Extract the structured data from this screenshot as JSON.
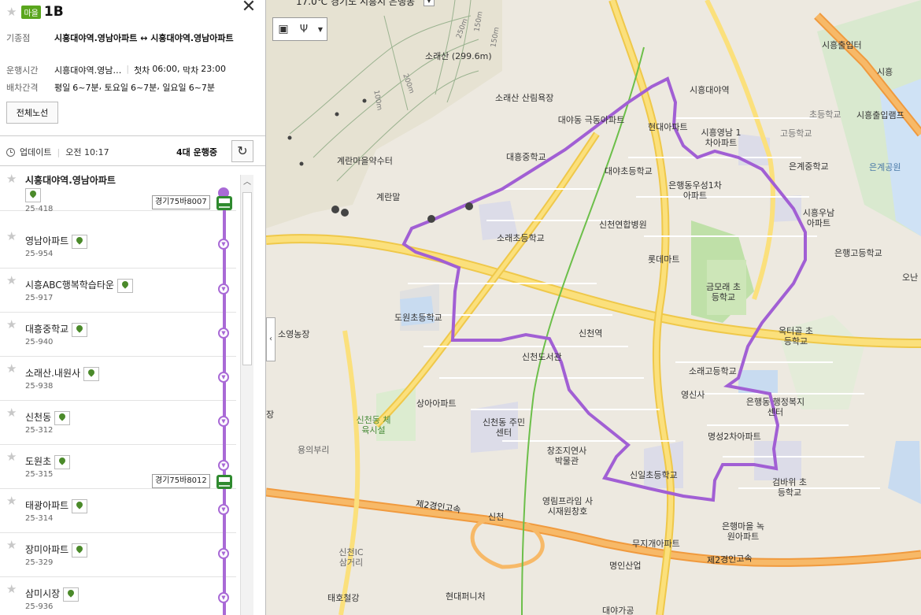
{
  "route": {
    "type_badge": "마을",
    "number": "1B",
    "terminal_label": "기종점",
    "terminal_value": "시흥대야역.영남아파트 ↔ 시흥대야역.영남아파트",
    "hours_label": "운행시간",
    "hours_place": "시흥대야역.영남…",
    "first_label": "첫차",
    "first_time": "06:00",
    "last_label": "막차",
    "last_time": "23:00",
    "interval_label": "배차간격",
    "weekday_label": "평일",
    "weekday": "6~7분",
    "saturday_label": "토요일",
    "saturday": "6~7분",
    "sunday_label": "일요일",
    "sunday": "6~7분",
    "whole_route_button": "전체노선",
    "update_label": "업데이트",
    "update_time": "오전 10:17",
    "running": "4대 운행중"
  },
  "stops": [
    {
      "name": "시흥대야역.영남아파트",
      "id": "25-418"
    },
    {
      "name": "영남아파트",
      "id": "25-954"
    },
    {
      "name": "시흥ABC행복학습타운",
      "id": "25-917"
    },
    {
      "name": "대흥중학교",
      "id": "25-940"
    },
    {
      "name": "소래산.내원사",
      "id": "25-938"
    },
    {
      "name": "신천동",
      "id": "25-312"
    },
    {
      "name": "도원초",
      "id": "25-315"
    },
    {
      "name": "태광아파트",
      "id": "25-314"
    },
    {
      "name": "장미아파트",
      "id": "25-329"
    },
    {
      "name": "삼미시장",
      "id": "25-936"
    }
  ],
  "buses": [
    {
      "plate": "경기75바8007"
    },
    {
      "plate": "경기75바8012"
    }
  ],
  "map": {
    "weather": "17.0℃ 경기도 시흥시 은행동",
    "toolbar_icons": [
      "bus-icon",
      "restaurant-icon",
      "dropdown-icon"
    ],
    "route_color": "#a15fd4",
    "labels": [
      "소래산 (299.6m)",
      "소래산 산림욕장",
      "계란마을약수터",
      "계란말",
      "대야동 극동아파트",
      "대흥중학교",
      "현대아파트",
      "시흥대야역",
      "시흥영남 1차아파트",
      "대야초등학교",
      "은행동우성1차 아파트",
      "신천연합병원",
      "소래초등학교",
      "롯데마트",
      "금모래 초등학교",
      "시흥우남 아파트",
      "은행고등학교",
      "은계중학교",
      "초등학교",
      "고등학교",
      "시흥출입램프",
      "시흥출입터",
      "시흥",
      "은계공원",
      "오난",
      "소영농장",
      "도원초등학교",
      "신천역",
      "신천도서관",
      "옥터골 초등학교",
      "소래고등학교",
      "영신사",
      "은행동 행정복지센터",
      "상아아파트",
      "신천동 주민센터",
      "명성2차아파트",
      "신천동 체육시설",
      "용의부리",
      "창조지연사 박물관",
      "신일초등학교",
      "검바위 초등학교",
      "제2경인고속",
      "신천",
      "영림프라임 사시재원창호",
      "은행마을 녹원아파트",
      "무지개아파트",
      "신천IC 삼거리",
      "명인산업",
      "태호철강",
      "현대퍼니처",
      "대야가공",
      "제2경인고속",
      "장",
      "250m",
      "200m",
      "150m",
      "100m",
      "150m"
    ]
  }
}
